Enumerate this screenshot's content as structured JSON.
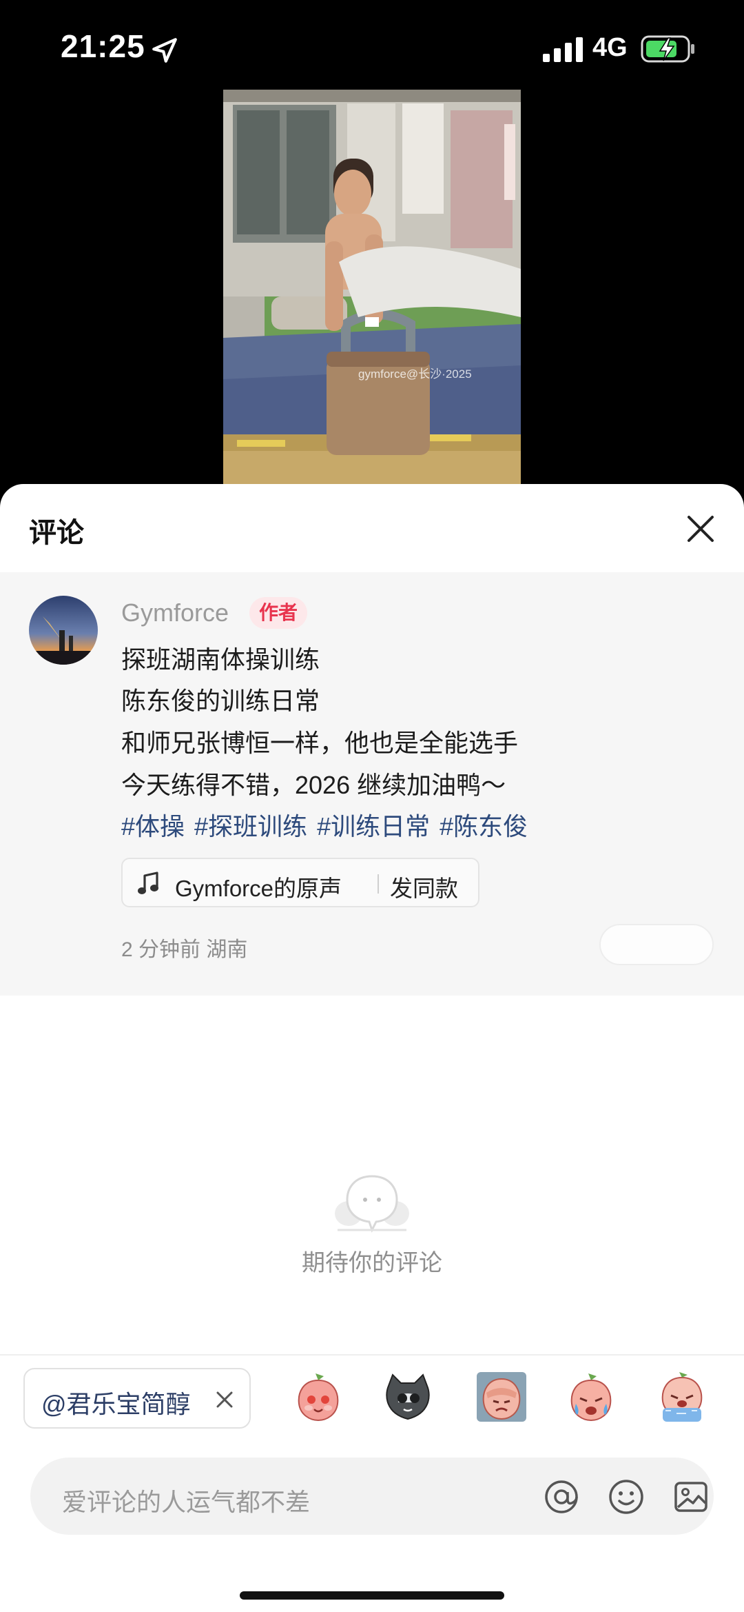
{
  "status_bar": {
    "time": "21:25",
    "network": "4G",
    "icons": [
      "location-arrow-icon",
      "signal-icon",
      "battery-charging-icon"
    ]
  },
  "video": {
    "watermark": "gymforce@长沙·2025"
  },
  "sheet": {
    "title": "评论",
    "close_icon": "close-icon"
  },
  "post": {
    "author": "Gymforce",
    "author_badge": "作者",
    "lines": [
      "探班湖南体操训练",
      "陈东俊的训练日常",
      "和师兄张博恒一样，他也是全能选手",
      "今天练得不错，2026 继续加油鸭～"
    ],
    "hashtags": [
      "#体操",
      "#探班训练",
      "#训练日常",
      "#陈东俊"
    ],
    "music": {
      "title": "Gymforce的原声",
      "action": "发同款",
      "icon": "music-note-icon"
    },
    "meta": "2 分钟前  湖南"
  },
  "empty_state": {
    "text": "期待你的评论",
    "icon": "speech-bubble-icon"
  },
  "composer": {
    "mention_chip": "@君乐宝简醇",
    "emojis": [
      "blushing-peach-emoji",
      "sunglasses-cat-emoji",
      "facepalm-peach-emoji",
      "crying-peach-emoji",
      "sobbing-peach-emoji"
    ],
    "placeholder": "爱评论的人运气都不差",
    "icons": [
      "at-icon",
      "smiley-icon",
      "image-icon"
    ]
  },
  "colors": {
    "accent_red": "#e8344e",
    "hashtag_blue": "#2d4a7c",
    "muted_gray": "#9a9a9a"
  }
}
